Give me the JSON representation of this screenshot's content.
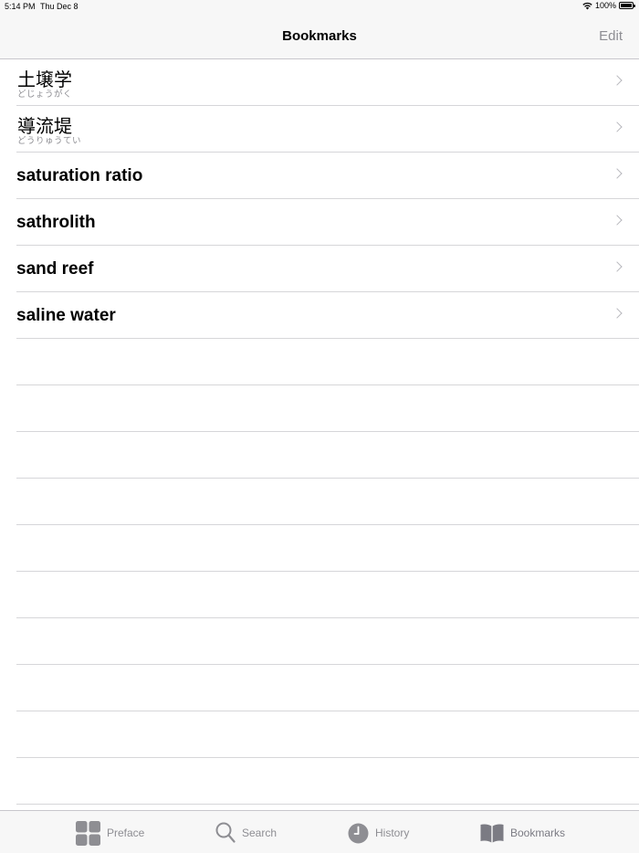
{
  "status_bar": {
    "time": "5:14 PM",
    "date": "Thu Dec 8",
    "battery": "100%"
  },
  "nav": {
    "title": "Bookmarks",
    "edit_label": "Edit"
  },
  "bookmarks": [
    {
      "term": "土壌学",
      "reading": "どじょうがく"
    },
    {
      "term": "導流堤",
      "reading": "どうりゅうてい"
    },
    {
      "term": "saturation ratio"
    },
    {
      "term": "sathrolith"
    },
    {
      "term": "sand reef"
    },
    {
      "term": "saline water"
    }
  ],
  "tabs": [
    {
      "label": "Preface",
      "icon": "grid-icon"
    },
    {
      "label": "Search",
      "icon": "search-icon"
    },
    {
      "label": "History",
      "icon": "clock-icon"
    },
    {
      "label": "Bookmarks",
      "icon": "book-icon"
    }
  ],
  "colors": {
    "bar_background": "#f7f7f7",
    "separator": "#d6d6d9",
    "secondary_text": "#8e8e93"
  }
}
